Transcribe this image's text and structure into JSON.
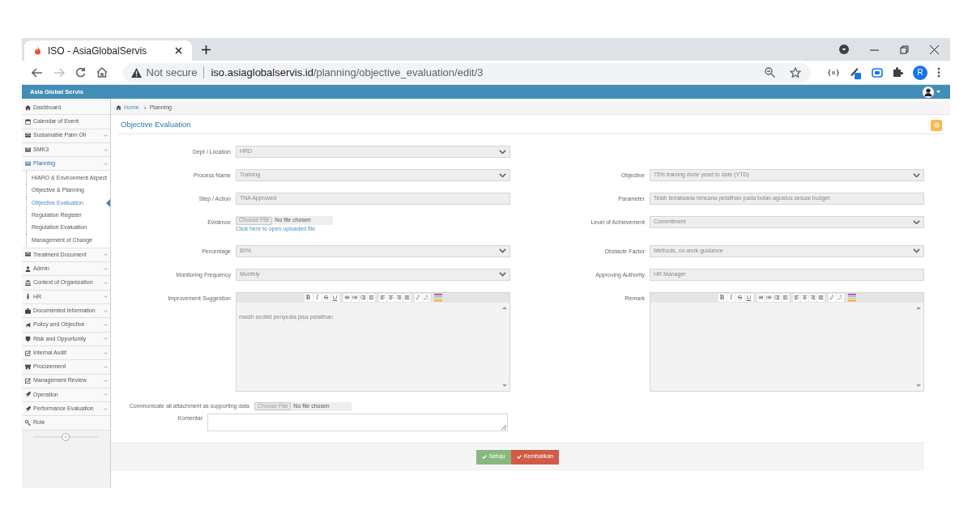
{
  "browser": {
    "tab": {
      "title": "ISO - AsiaGlobalServis"
    },
    "address": {
      "security": "Not secure",
      "host": "iso.asiaglobalservis.id",
      "path": "/planning/objective_evaluation/edit/3"
    },
    "profile": "R"
  },
  "app": {
    "brand": "Asia Global Servis"
  },
  "sidebar": {
    "items": [
      {
        "label": "Dashboard",
        "expandable": false,
        "expanded": false
      },
      {
        "label": "Calendar of Event",
        "expandable": false,
        "expanded": false
      },
      {
        "label": "Sustainable Palm Oil",
        "expandable": true,
        "expanded": false
      },
      {
        "label": "SMK3",
        "expandable": true,
        "expanded": false
      },
      {
        "label": "Planning",
        "expandable": true,
        "expanded": true,
        "children": [
          {
            "label": "HIARO & Environment Aspect",
            "selected": false
          },
          {
            "label": "Objective & Planning",
            "selected": false
          },
          {
            "label": "Objective Evaluation",
            "selected": true
          },
          {
            "label": "Regulation Register",
            "selected": false
          },
          {
            "label": "Regulation Evaluation",
            "selected": false
          },
          {
            "label": "Management of Change",
            "selected": false
          }
        ]
      },
      {
        "label": "Treatment Document",
        "expandable": true,
        "expanded": false
      },
      {
        "label": "Admin",
        "expandable": true,
        "expanded": false
      },
      {
        "label": "Context of Organization",
        "expandable": true,
        "expanded": false
      },
      {
        "label": "HR",
        "expandable": true,
        "expanded": false
      },
      {
        "label": "Documented Information",
        "expandable": true,
        "expanded": false
      },
      {
        "label": "Policy and Objective",
        "expandable": true,
        "expanded": false
      },
      {
        "label": "Risk and Opportunity",
        "expandable": true,
        "expanded": false
      },
      {
        "label": "Internal Audit",
        "expandable": true,
        "expanded": false
      },
      {
        "label": "Procurement",
        "expandable": true,
        "expanded": false
      },
      {
        "label": "Management Review",
        "expandable": true,
        "expanded": false
      },
      {
        "label": "Operation",
        "expandable": true,
        "expanded": false
      },
      {
        "label": "Performance Evaluation",
        "expandable": true,
        "expanded": false
      },
      {
        "label": "Role",
        "expandable": false,
        "expanded": false
      }
    ]
  },
  "breadcrumb": [
    "Home",
    "Planning"
  ],
  "page_title": "Objective Evaluation",
  "form": {
    "rows": [
      {
        "left": {
          "label": "Dept / Location",
          "kind": "select",
          "value": "HRD",
          "disabled": true
        }
      },
      {
        "left": {
          "label": "Process Name",
          "kind": "select",
          "value": "Training",
          "disabled": true
        },
        "right": {
          "label": "Objective",
          "kind": "select",
          "value": "75% training done yeart to date (YTD)",
          "disabled": true
        }
      },
      {
        "left": {
          "label": "Step / Action",
          "kind": "text",
          "value": "TNA Approved",
          "disabled": true
        },
        "right": {
          "label": "Parameter",
          "kind": "text",
          "value": "Telah terlaksana rencana pelatihan pada bulan agustus sesuai budget",
          "disabled": true
        }
      },
      {
        "left": {
          "label": "Evidence",
          "kind": "file",
          "button": "Choose File",
          "status": "No file chosen",
          "link": "Click here to open uploaded file",
          "disabled": true
        },
        "right": {
          "label": "Level of Achievement",
          "kind": "select",
          "value": "Commitment",
          "disabled": true
        }
      },
      {
        "left": {
          "label": "Percentage",
          "kind": "select",
          "value": "80%",
          "disabled": true
        },
        "right": {
          "label": "Obstacle Factor",
          "kind": "select",
          "value": "Methods, no work guidance",
          "disabled": true
        }
      },
      {
        "left": {
          "label": "Monitoring Frequency",
          "kind": "select",
          "value": "Monthly",
          "disabled": true
        },
        "right": {
          "label": "Approving Authority",
          "kind": "text",
          "value": "HR Manager",
          "disabled": true
        }
      },
      {
        "left": {
          "label": "Improvement Suggestion",
          "kind": "editor",
          "value": "masih sedikit penyedia jasa pelatihan",
          "disabled": true,
          "toolbar": [
            {
              "kind": "bold",
              "label": "B"
            },
            {
              "kind": "italic",
              "label": "I"
            },
            {
              "kind": "strike",
              "label": "S"
            },
            {
              "kind": "underline",
              "label": "U"
            },
            {
              "kind": "ul"
            },
            {
              "kind": "ol"
            },
            {
              "kind": "outdent"
            },
            {
              "kind": "indent"
            },
            {
              "kind": "left"
            },
            {
              "kind": "center"
            },
            {
              "kind": "right"
            },
            {
              "kind": "justify"
            },
            {
              "kind": "link"
            },
            {
              "kind": "unlink"
            },
            {
              "kind": "color"
            }
          ]
        },
        "right": {
          "label": "Remark",
          "kind": "editor",
          "disabled": true,
          "toolbar": [
            {
              "kind": "bold",
              "label": "B"
            },
            {
              "kind": "italic",
              "label": "I"
            },
            {
              "kind": "strike",
              "label": "S"
            },
            {
              "kind": "underline",
              "label": "U"
            },
            {
              "kind": "ul"
            },
            {
              "kind": "ol"
            },
            {
              "kind": "outdent"
            },
            {
              "kind": "indent"
            },
            {
              "kind": "left"
            },
            {
              "kind": "center"
            },
            {
              "kind": "right"
            },
            {
              "kind": "justify"
            },
            {
              "kind": "link"
            },
            {
              "kind": "unlink"
            },
            {
              "kind": "color"
            }
          ]
        }
      }
    ],
    "attachment": {
      "label": "Communicate all attachment as supporting data",
      "button": "Choose File",
      "status": "No file chosen"
    },
    "comment": {
      "label": "Komentar",
      "disabled": false
    }
  },
  "buttons": [
    {
      "label": "Setuju",
      "kind": "approve"
    },
    {
      "label": "Kembalikan",
      "kind": "return"
    }
  ]
}
